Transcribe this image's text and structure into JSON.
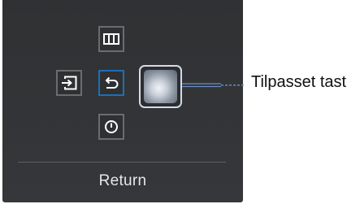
{
  "osd": {
    "keys": {
      "top_icon": "columns-icon",
      "left_icon": "input-source-icon",
      "center_icon": "return-arrow-icon",
      "bottom_icon": "power-icon",
      "right_icon": "custom-key-thumbnail"
    },
    "footer_label": "Return"
  },
  "callout": {
    "label": "Tilpasset tast"
  },
  "colors": {
    "panel_bg": "#323436",
    "key_border": "#6a6c6f",
    "selected_border": "#1f6fb5",
    "text": "#e6e6e6"
  }
}
